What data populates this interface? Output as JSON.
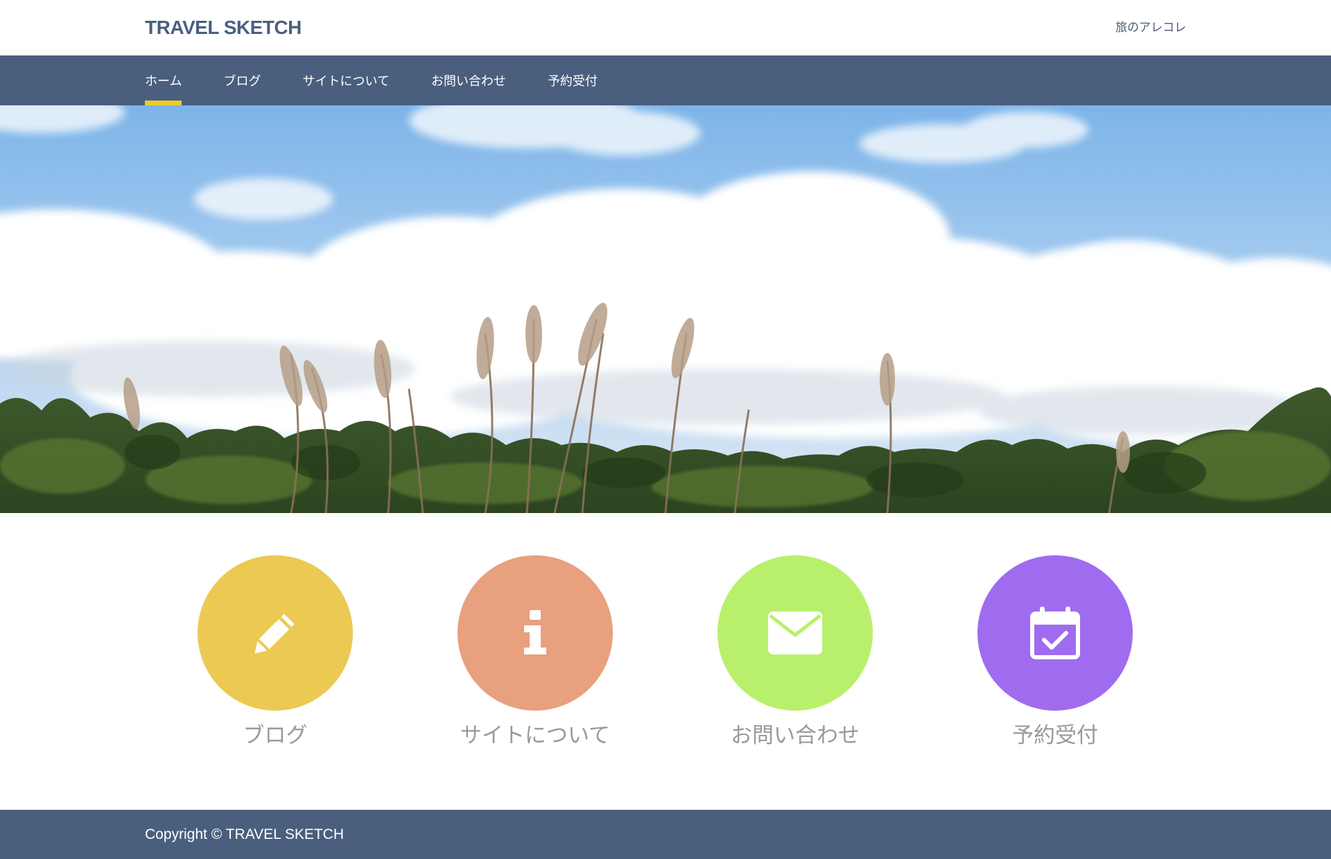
{
  "header": {
    "logo": "TRAVEL SKETCH",
    "tagline": "旅のアレコレ"
  },
  "nav": {
    "items": [
      {
        "label": "ホーム",
        "active": true
      },
      {
        "label": "ブログ",
        "active": false
      },
      {
        "label": "サイトについて",
        "active": false
      },
      {
        "label": "お問い合わせ",
        "active": false
      },
      {
        "label": "予約受付",
        "active": false
      }
    ],
    "active_indicator_color": "#e8cc2e"
  },
  "features": [
    {
      "label": "ブログ",
      "icon": "pencil-icon",
      "color": "#ebc952"
    },
    {
      "label": "サイトについて",
      "icon": "info-icon",
      "color": "#e8a07f"
    },
    {
      "label": "お問い合わせ",
      "icon": "envelope-icon",
      "color": "#b9f06b"
    },
    {
      "label": "予約受付",
      "icon": "calendar-check-icon",
      "color": "#a06cef"
    }
  ],
  "footer": {
    "copyright": "Copyright © TRAVEL SKETCH"
  },
  "colors": {
    "nav_bg": "#4a5f7e",
    "logo": "#4a5f80",
    "feature_label": "#9a9a9a"
  }
}
